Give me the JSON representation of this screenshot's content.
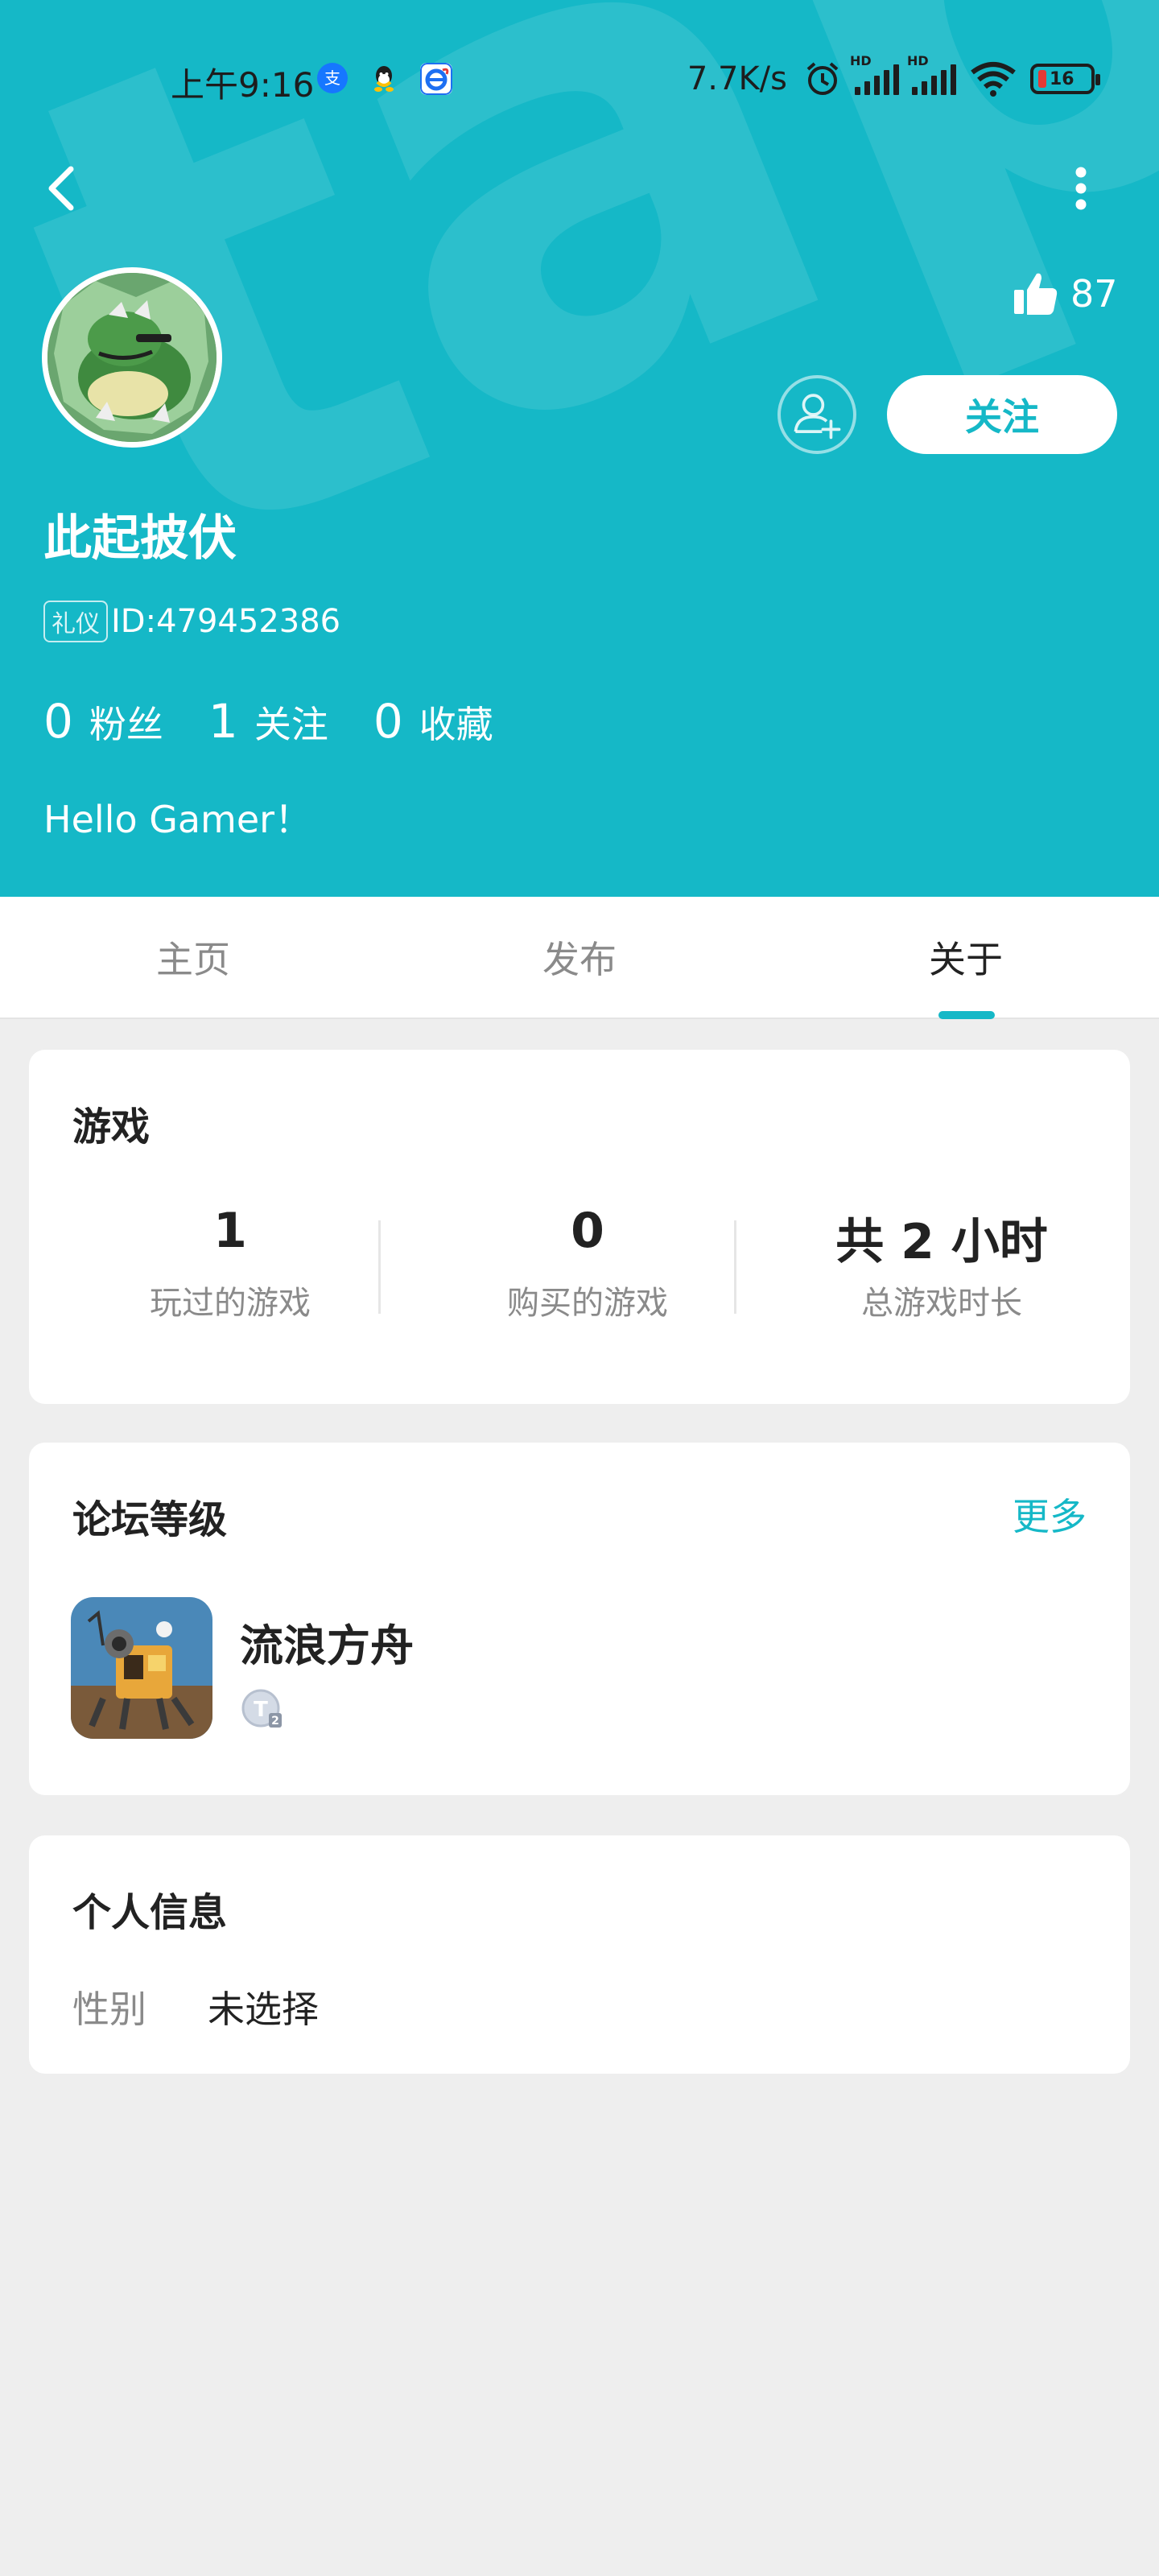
{
  "status_bar": {
    "time": "上午9:16",
    "alipay_glyph": "支",
    "net_speed": "7.7K/s",
    "battery": "16",
    "icons": [
      "alipay-icon",
      "qq-icon",
      "browser-icon",
      "alarm-icon",
      "hd-signal-icon",
      "hd-signal-icon",
      "wifi-icon",
      "battery-icon"
    ]
  },
  "header": {
    "watermark": "tapTap",
    "like_count": "87",
    "follow_label": "关注",
    "username": "此起披伏",
    "id_tag": "礼仪",
    "id_text": "ID:479452386",
    "stats": [
      {
        "num": "0",
        "label": "粉丝"
      },
      {
        "num": "1",
        "label": "关注"
      },
      {
        "num": "0",
        "label": "收藏"
      }
    ],
    "bio": "Hello Gamer！",
    "accent_color": "#15b8c7"
  },
  "tabs": [
    {
      "label": "主页"
    },
    {
      "label": "发布"
    },
    {
      "label": "关于",
      "active": true
    }
  ],
  "games": {
    "title": "游戏",
    "stats": [
      {
        "value": "1",
        "label": "玩过的游戏"
      },
      {
        "value": "0",
        "label": "购买的游戏"
      },
      {
        "value": "共 2 小时",
        "label": "总游戏时长"
      }
    ]
  },
  "forum": {
    "title": "论坛等级",
    "more_label": "更多",
    "game_name": "流浪方舟",
    "level_badge": "T2"
  },
  "personal": {
    "title": "个人信息",
    "gender_label": "性别",
    "gender_value": "未选择"
  }
}
